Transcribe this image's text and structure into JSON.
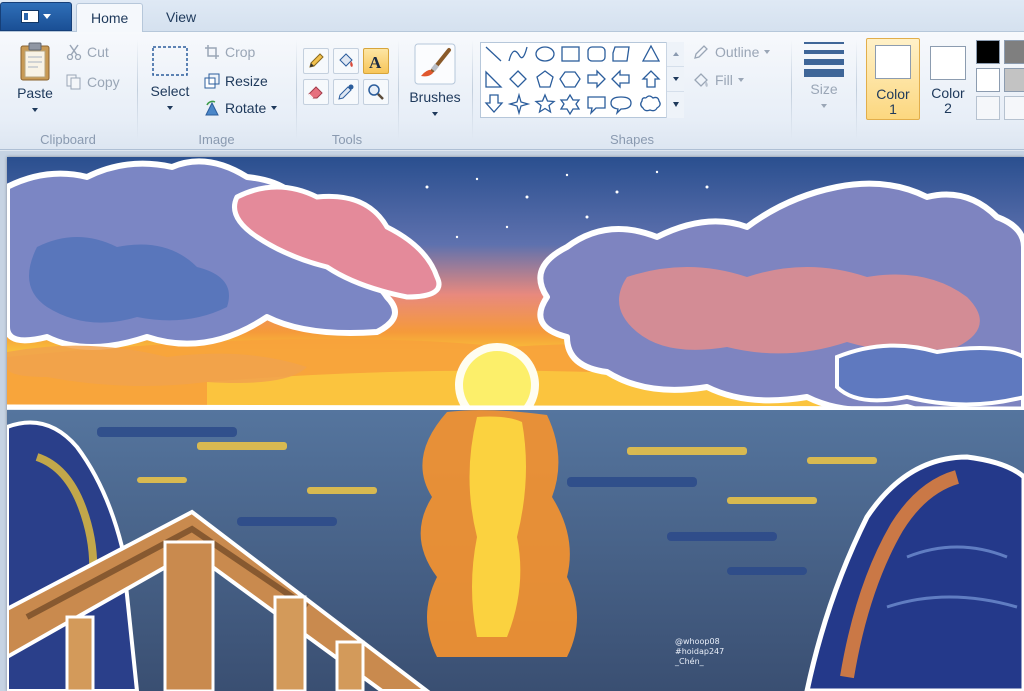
{
  "tabs": {
    "home": "Home",
    "view": "View"
  },
  "clipboard": {
    "paste": "Paste",
    "cut": "Cut",
    "copy": "Copy",
    "label": "Clipboard"
  },
  "image": {
    "select": "Select",
    "crop": "Crop",
    "resize": "Resize",
    "rotate": "Rotate",
    "label": "Image"
  },
  "tools": {
    "label": "Tools",
    "items": [
      "pencil",
      "fill",
      "text",
      "eraser",
      "color-picker",
      "magnifier"
    ]
  },
  "brushes": {
    "label": "Brushes"
  },
  "shapes": {
    "label": "Shapes",
    "outline": "Outline",
    "fill": "Fill"
  },
  "size": {
    "label": "Size"
  },
  "colors": {
    "color1": {
      "line1": "Color",
      "line2": "1",
      "value": "#000000"
    },
    "color2": {
      "line1": "Color",
      "line2": "2",
      "value": "#ffffff"
    },
    "palette": [
      "#000000",
      "#7f7f7f",
      "#ffffff",
      "#c3c3c3",
      "#ffffff",
      "#ffffff"
    ]
  },
  "canvas": {
    "signature": [
      "@whoop08",
      "#hoidap247",
      "_Chén_"
    ]
  }
}
